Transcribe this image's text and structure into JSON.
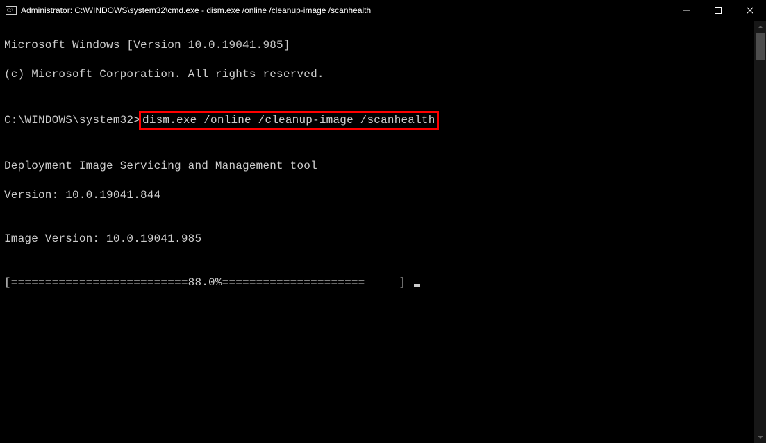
{
  "titlebar": {
    "title": "Administrator: C:\\WINDOWS\\system32\\cmd.exe - dism.exe  /online /cleanup-image /scanhealth"
  },
  "terminal": {
    "line_version": "Microsoft Windows [Version 10.0.19041.985]",
    "line_copyright": "(c) Microsoft Corporation. All rights reserved.",
    "prompt_prefix": "C:\\WINDOWS\\system32>",
    "command": "dism.exe /online /cleanup-image /scanhealth",
    "spacer": "",
    "tool_name": "Deployment Image Servicing and Management tool",
    "tool_version": "Version: 10.0.19041.844",
    "image_version": "Image Version: 10.0.19041.985",
    "progress_line": "[==========================88.0%=====================     ] "
  }
}
